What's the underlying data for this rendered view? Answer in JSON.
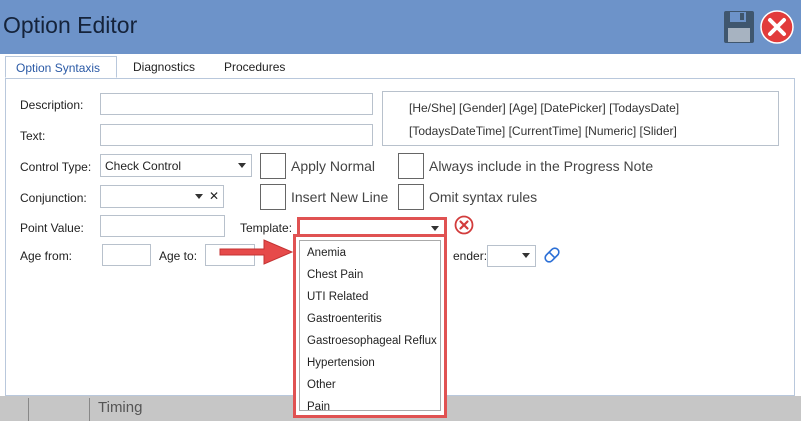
{
  "window": {
    "title": "Option Editor",
    "save_icon": "floppy-disk-icon",
    "close_icon": "close-circle-icon"
  },
  "tabs": [
    {
      "label": "Option Syntaxis",
      "active": true
    },
    {
      "label": "Diagnostics",
      "active": false
    },
    {
      "label": "Procedures",
      "active": false
    }
  ],
  "form": {
    "description_label": "Description:",
    "description_value": "",
    "text_label": "Text:",
    "text_value": "",
    "control_type_label": "Control Type:",
    "control_type_value": "Check Control",
    "conjunction_label": "Conjunction:",
    "conjunction_value": "",
    "conjunction_clear": "✕",
    "point_value_label": "Point Value:",
    "point_value": "",
    "template_label": "Template:",
    "template_value": "",
    "age_from_label": "Age from:",
    "age_from_value": "",
    "age_to_label": "Age to:",
    "age_to_value": "",
    "gender_label": "ender:",
    "gender_value": ""
  },
  "syntax_tokens": {
    "line1": "[He/She]  [Gender]  [Age]  [DatePicker]  [TodaysDate]",
    "line2": "[TodaysDateTime]  [CurrentTime]  [Numeric]  [Slider]"
  },
  "checkboxes": {
    "apply_normal": {
      "label": "Apply Normal",
      "checked": false
    },
    "insert_new_line": {
      "label": "Insert New Line",
      "checked": false
    },
    "always_include": {
      "label": "Always include in the Progress Note",
      "checked": false
    },
    "omit_syntax": {
      "label": "Omit syntax rules",
      "checked": false
    }
  },
  "template_options": [
    "Anemia",
    "Chest Pain",
    "UTI Related",
    "Gastroenteritis",
    "Gastroesophageal Reflux",
    "Hypertension",
    "Other",
    "Pain"
  ],
  "bottom": {
    "label": "Timing"
  },
  "colors": {
    "titlebar": "#6d93c9",
    "highlight": "#e05252",
    "accent": "#2b5aa6"
  }
}
